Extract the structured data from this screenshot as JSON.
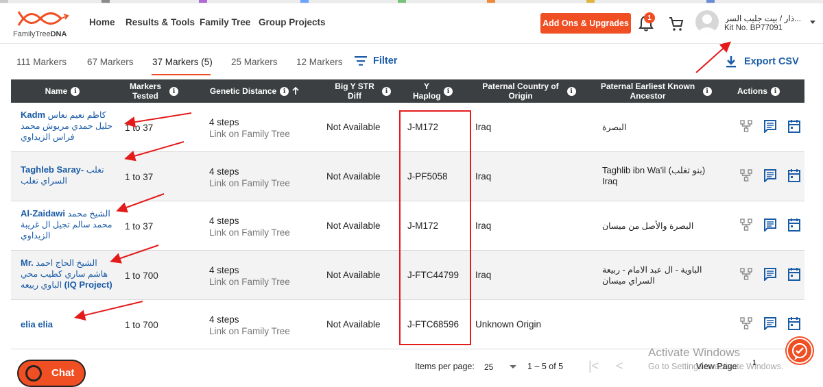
{
  "header": {
    "logo_text_prefix": "FamilyTree",
    "logo_text_bold": "DNA",
    "nav": [
      "Home",
      "Results & Tools",
      "Family Tree",
      "Group Projects"
    ],
    "addons_label": "Add Ons & Upgrades",
    "notification_count": "1",
    "user_name": "...ذار / بيت جليب السراي",
    "kit_no": "Kit No. BP77091"
  },
  "tabs": {
    "items": [
      "111 Markers",
      "67 Markers",
      "37 Markers (5)",
      "25 Markers",
      "12 Markers"
    ],
    "active_index": 2,
    "filter_label": "Filter",
    "export_label": "Export CSV"
  },
  "table": {
    "columns": {
      "name": "Name",
      "markers_tested": "Markers Tested",
      "genetic_distance": "Genetic Distance",
      "big_y": "Big Y STR Diff",
      "y_haplo": "Y Haplog",
      "paternal_country": "Paternal Country of Origin",
      "ancestor": "Paternal Earliest Known Ancestor",
      "actions": "Actions"
    },
    "rows": [
      {
        "name_en": "Kadm",
        "name_ar": "كاظم نعيم نعاس حليل حمدي مريوش محمد فراس الزيداوي",
        "markers": "1 to 37",
        "steps": "4 steps",
        "link": "Link on Family Tree",
        "bigy": "Not Available",
        "haplo": "J-M172",
        "country": "Iraq",
        "ancestor": "البصرة"
      },
      {
        "name_en": "Taghleb Saray-",
        "name_ar": "تغلب السراي تغلب",
        "markers": "1 to 37",
        "steps": "4 steps",
        "link": "Link on Family Tree",
        "bigy": "Not Available",
        "haplo": "J-PF5058",
        "country": "Iraq",
        "ancestor": "Taghlib ibn Wa'il (بنو تغلب) Iraq"
      },
      {
        "name_en": "Al-Zaidawi",
        "name_ar": "الشيخ محمد محمد سالم تجيل ال غريبة الزيداوي",
        "markers": "1 to 37",
        "steps": "4 steps",
        "link": "Link on Family Tree",
        "bigy": "Not Available",
        "haplo": "J-M172",
        "country": "Iraq",
        "ancestor": "البصرة والأصل من ميسان"
      },
      {
        "name_en": "Mr.",
        "name_ar": "الشيخ الحاج احمد هاشم ساري كطيب محي الباوي ربيعه",
        "name_suffix": "(IQ Project)",
        "markers": "1 to 700",
        "steps": "4 steps",
        "link": "Link on Family Tree",
        "bigy": "Not Available",
        "haplo": "J-FTC44799",
        "country": "Iraq",
        "ancestor": "الباوية - ال عبد الامام - ربيعة السراي ميسان"
      },
      {
        "name_en": "elia elia",
        "name_ar": "",
        "markers": "1 to 700",
        "steps": "4 steps",
        "link": "Link on Family Tree",
        "bigy": "Not Available",
        "haplo": "J-FTC68596",
        "country": "Unknown Origin",
        "ancestor": ""
      }
    ]
  },
  "footer": {
    "chat_label": "Chat",
    "items_per_page_label": "Items per page:",
    "items_per_page_value": "25",
    "range": "1 – 5 of 5",
    "activate_title": "Activate Windows",
    "activate_sub": "Go to Settings to activate Windows.",
    "view_page_label": "View Page",
    "page_number": "1"
  },
  "colors": {
    "brand_orange": "#f04e23",
    "link_blue": "#1a5ba6",
    "header_dark": "#3c3f41",
    "annotation_red": "#e41b1b"
  }
}
